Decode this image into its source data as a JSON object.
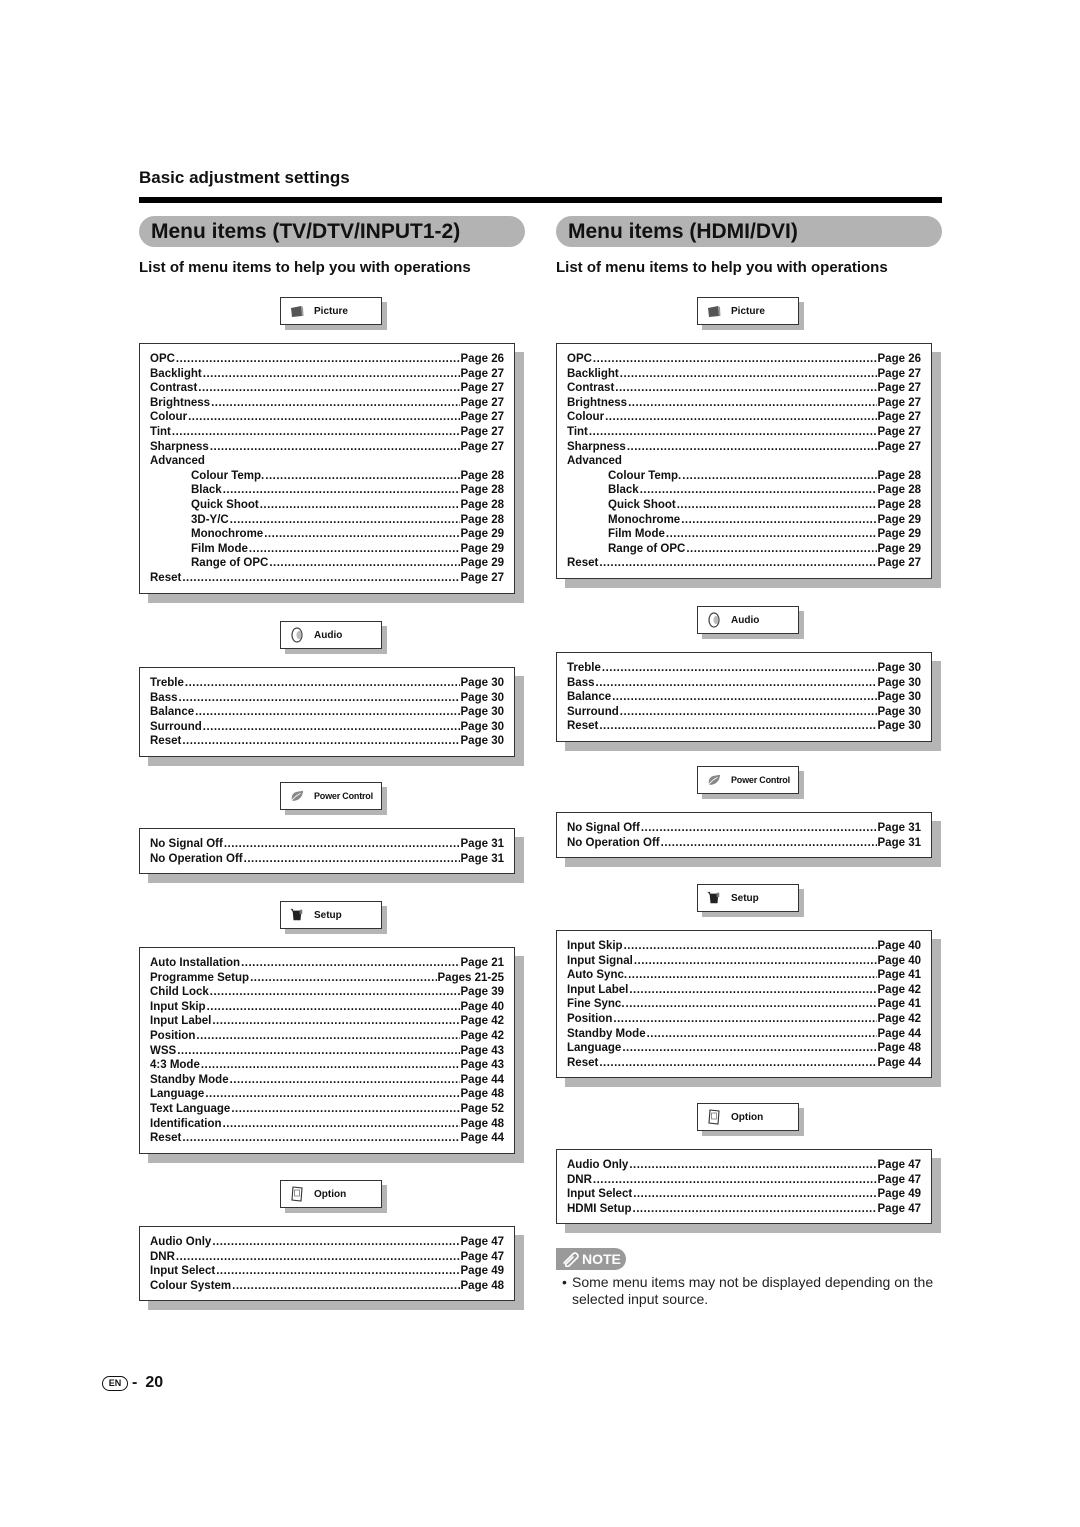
{
  "header": {
    "section_title": "Basic adjustment settings"
  },
  "left": {
    "title": "Menu items (TV/DTV/INPUT1-2)",
    "subtitle": "List of menu items to help you with operations",
    "categories": [
      {
        "label": "Picture",
        "icon": "picture-icon",
        "items": [
          {
            "name": "OPC",
            "page": "Page 26"
          },
          {
            "name": "Backlight",
            "page": "Page 27"
          },
          {
            "name": "Contrast",
            "page": "Page 27"
          },
          {
            "name": "Brightness",
            "page": "Page 27"
          },
          {
            "name": "Colour",
            "page": "Page 27"
          },
          {
            "name": "Tint",
            "page": "Page 27"
          },
          {
            "name": "Sharpness",
            "page": "Page 27"
          },
          {
            "name": "Advanced",
            "page": ""
          },
          {
            "name": "Colour Temp.",
            "page": "Page 28",
            "sub": true
          },
          {
            "name": "Black",
            "page": "Page 28",
            "sub": true
          },
          {
            "name": "Quick Shoot",
            "page": "Page 28",
            "sub": true
          },
          {
            "name": "3D-Y/C",
            "page": "Page 28",
            "sub": true
          },
          {
            "name": "Monochrome",
            "page": "Page 29",
            "sub": true
          },
          {
            "name": "Film Mode",
            "page": "Page 29",
            "sub": true
          },
          {
            "name": "Range of OPC",
            "page": "Page 29",
            "sub": true
          },
          {
            "name": "Reset",
            "page": "Page 27"
          }
        ]
      },
      {
        "label": "Audio",
        "icon": "speaker-icon",
        "items": [
          {
            "name": "Treble",
            "page": "Page 30"
          },
          {
            "name": "Bass",
            "page": "Page 30"
          },
          {
            "name": "Balance",
            "page": "Page 30"
          },
          {
            "name": "Surround",
            "page": "Page 30"
          },
          {
            "name": "Reset",
            "page": "Page 30"
          }
        ]
      },
      {
        "label": "Power Control",
        "icon": "leaf-icon",
        "items": [
          {
            "name": "No Signal Off",
            "page": "Page 31"
          },
          {
            "name": "No Operation Off",
            "page": "Page 31"
          }
        ]
      },
      {
        "label": "Setup",
        "icon": "setup-icon",
        "items": [
          {
            "name": "Auto Installation",
            "page": "Page 21"
          },
          {
            "name": "Programme Setup",
            "page": "Pages 21-25"
          },
          {
            "name": "Child Lock",
            "page": "Page 39"
          },
          {
            "name": "Input Skip",
            "page": "Page 40"
          },
          {
            "name": "Input Label",
            "page": "Page 42"
          },
          {
            "name": "Position",
            "page": "Page 42"
          },
          {
            "name": "WSS",
            "page": "Page 43"
          },
          {
            "name": "4:3 Mode",
            "page": "Page 43"
          },
          {
            "name": "Standby Mode",
            "page": "Page 44"
          },
          {
            "name": "Language",
            "page": "Page 48"
          },
          {
            "name": "Text Language",
            "page": "Page 52"
          },
          {
            "name": "Identification",
            "page": "Page 48"
          },
          {
            "name": "Reset",
            "page": "Page 44"
          }
        ]
      },
      {
        "label": "Option",
        "icon": "option-icon",
        "items": [
          {
            "name": "Audio Only",
            "page": "Page 47"
          },
          {
            "name": "DNR",
            "page": "Page 47"
          },
          {
            "name": "Input Select",
            "page": "Page 49"
          },
          {
            "name": "Colour System",
            "page": "Page 48"
          }
        ]
      }
    ]
  },
  "right": {
    "title": "Menu items (HDMI/DVI)",
    "subtitle": "List of menu items to help you with operations",
    "categories": [
      {
        "label": "Picture",
        "icon": "picture-icon",
        "items": [
          {
            "name": "OPC",
            "page": "Page 26"
          },
          {
            "name": "Backlight",
            "page": "Page 27"
          },
          {
            "name": "Contrast",
            "page": "Page 27"
          },
          {
            "name": "Brightness",
            "page": "Page 27"
          },
          {
            "name": "Colour",
            "page": "Page 27"
          },
          {
            "name": "Tint",
            "page": "Page 27"
          },
          {
            "name": "Sharpness",
            "page": "Page 27"
          },
          {
            "name": "Advanced",
            "page": ""
          },
          {
            "name": "Colour Temp.",
            "page": "Page 28",
            "sub": true
          },
          {
            "name": "Black",
            "page": "Page 28",
            "sub": true
          },
          {
            "name": "Quick Shoot",
            "page": "Page 28",
            "sub": true
          },
          {
            "name": "Monochrome",
            "page": "Page 29",
            "sub": true
          },
          {
            "name": "Film Mode",
            "page": "Page 29",
            "sub": true
          },
          {
            "name": "Range of OPC",
            "page": "Page 29",
            "sub": true
          },
          {
            "name": "Reset",
            "page": "Page 27"
          }
        ]
      },
      {
        "label": "Audio",
        "icon": "speaker-icon",
        "items": [
          {
            "name": "Treble",
            "page": "Page 30"
          },
          {
            "name": "Bass",
            "page": "Page 30"
          },
          {
            "name": "Balance",
            "page": "Page 30"
          },
          {
            "name": "Surround",
            "page": "Page 30"
          },
          {
            "name": "Reset",
            "page": "Page 30"
          }
        ]
      },
      {
        "label": "Power Control",
        "icon": "leaf-icon",
        "items": [
          {
            "name": "No Signal Off",
            "page": "Page 31"
          },
          {
            "name": "No Operation Off",
            "page": "Page 31"
          }
        ]
      },
      {
        "label": "Setup",
        "icon": "setup-icon",
        "items": [
          {
            "name": "Input Skip",
            "page": "Page 40"
          },
          {
            "name": "Input Signal",
            "page": "Page 40"
          },
          {
            "name": "Auto Sync.",
            "page": "Page 41"
          },
          {
            "name": "Input Label",
            "page": "Page 42"
          },
          {
            "name": "Fine Sync.",
            "page": "Page 41"
          },
          {
            "name": "Position",
            "page": "Page 42"
          },
          {
            "name": "Standby Mode",
            "page": "Page 44"
          },
          {
            "name": "Language",
            "page": "Page 48"
          },
          {
            "name": "Reset",
            "page": "Page 44"
          }
        ]
      },
      {
        "label": "Option",
        "icon": "option-icon",
        "items": [
          {
            "name": "Audio Only",
            "page": "Page 47"
          },
          {
            "name": "DNR",
            "page": "Page 47"
          },
          {
            "name": "Input Select",
            "page": "Page 49"
          },
          {
            "name": "HDMI Setup",
            "page": "Page 47"
          }
        ]
      }
    ]
  },
  "note": {
    "badge": "NOTE",
    "bullet": "•",
    "text": "Some menu items may not be displayed depending on the selected input source."
  },
  "footer": {
    "lang_badge": "EN",
    "separator": "-",
    "page_number": "20"
  }
}
